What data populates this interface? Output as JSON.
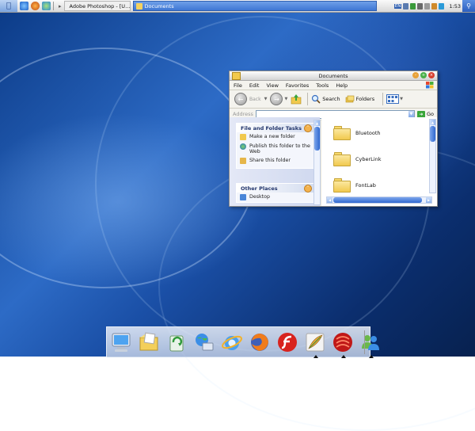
{
  "topbar": {
    "tasks": [
      {
        "label": "Adobe Photoshop - [U...",
        "icon": "photoshop-icon",
        "active": false
      },
      {
        "label": "Documents",
        "icon": "folder-icon",
        "active": true
      }
    ],
    "tray_lang": "EN",
    "clock": "1:53"
  },
  "window": {
    "title": "Documents",
    "menu": [
      "File",
      "Edit",
      "View",
      "Favorites",
      "Tools",
      "Help"
    ],
    "toolbar": {
      "back_label": "Back",
      "search_label": "Search",
      "folders_label": "Folders"
    },
    "address": {
      "label": "Address",
      "value": "",
      "go_label": "Go"
    },
    "file_tasks": {
      "title": "File and Folder Tasks",
      "items": [
        "Make a new folder",
        "Publish this folder to the Web",
        "Share this folder"
      ]
    },
    "other_places": {
      "title": "Other Places",
      "items": [
        "Desktop"
      ]
    },
    "folders": [
      "Bluetooth",
      "CyberLink",
      "FontLab"
    ]
  },
  "dock": {
    "items": [
      {
        "icon": "my-computer-icon",
        "running": false
      },
      {
        "icon": "documents-folder-icon",
        "running": false
      },
      {
        "icon": "recycle-icon",
        "running": false
      },
      {
        "icon": "network-globe-icon",
        "running": false
      },
      {
        "icon": "internet-explorer-icon",
        "running": false
      },
      {
        "icon": "firefox-icon",
        "running": false
      },
      {
        "icon": "flash-icon",
        "running": false
      },
      {
        "icon": "photoshop-feather-icon",
        "running": true
      },
      {
        "icon": "media-player-icon",
        "running": true
      },
      {
        "icon": "messenger-icon",
        "running": true
      }
    ]
  },
  "colors": {
    "desktop_blue": "#1a4fa6",
    "selection_blue": "#3e76d4",
    "folder_yellow": "#f1c94e"
  }
}
